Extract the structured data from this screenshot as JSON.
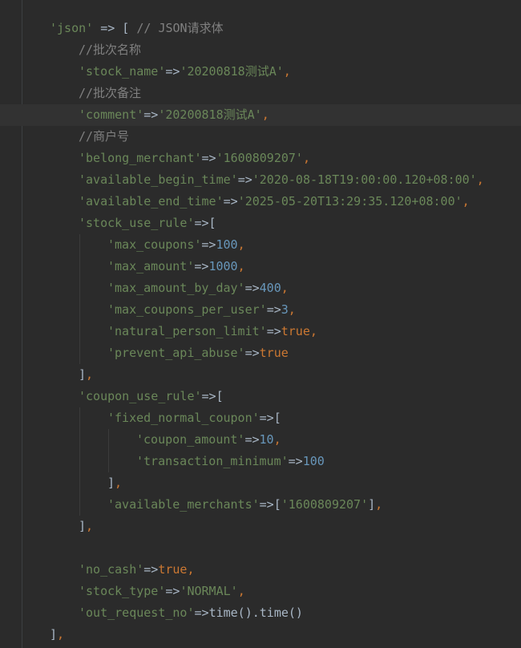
{
  "editor": {
    "current_line": 4,
    "lines": [
      {
        "indent": 0,
        "tokens": [
          {
            "t": "'json'",
            "c": "str"
          },
          {
            "t": " => [ ",
            "c": "op"
          },
          {
            "t": "// JSON请求体",
            "c": "cmt"
          }
        ]
      },
      {
        "indent": 1,
        "tokens": [
          {
            "t": "//批次名称",
            "c": "cmt"
          }
        ]
      },
      {
        "indent": 1,
        "tokens": [
          {
            "t": "'stock_name'",
            "c": "str"
          },
          {
            "t": "=>",
            "c": "op"
          },
          {
            "t": "'20200818测试A'",
            "c": "str"
          },
          {
            "t": ",",
            "c": "kw"
          }
        ]
      },
      {
        "indent": 1,
        "tokens": [
          {
            "t": "//批次备注",
            "c": "cmt"
          }
        ]
      },
      {
        "indent": 1,
        "tokens": [
          {
            "t": "'comment'",
            "c": "str"
          },
          {
            "t": "=>",
            "c": "op"
          },
          {
            "t": "'20200818测试A'",
            "c": "str"
          },
          {
            "t": ",",
            "c": "kw"
          }
        ]
      },
      {
        "indent": 1,
        "tokens": [
          {
            "t": "//商户号",
            "c": "cmt"
          }
        ]
      },
      {
        "indent": 1,
        "tokens": [
          {
            "t": "'belong_merchant'",
            "c": "str"
          },
          {
            "t": "=>",
            "c": "op"
          },
          {
            "t": "'1600809207'",
            "c": "str"
          },
          {
            "t": ",",
            "c": "kw"
          }
        ]
      },
      {
        "indent": 1,
        "tokens": [
          {
            "t": "'available_begin_time'",
            "c": "str"
          },
          {
            "t": "=>",
            "c": "op"
          },
          {
            "t": "'2020-08-18T19:00:00.120+08:00'",
            "c": "str"
          },
          {
            "t": ",",
            "c": "kw"
          }
        ]
      },
      {
        "indent": 1,
        "tokens": [
          {
            "t": "'available_end_time'",
            "c": "str"
          },
          {
            "t": "=>",
            "c": "op"
          },
          {
            "t": "'2025-05-20T13:29:35.120+08:00'",
            "c": "str"
          },
          {
            "t": ",",
            "c": "kw"
          }
        ]
      },
      {
        "indent": 1,
        "tokens": [
          {
            "t": "'stock_use_rule'",
            "c": "str"
          },
          {
            "t": "=>[",
            "c": "op"
          }
        ]
      },
      {
        "indent": 2,
        "tokens": [
          {
            "t": "'max_coupons'",
            "c": "str"
          },
          {
            "t": "=>",
            "c": "op"
          },
          {
            "t": "100",
            "c": "num"
          },
          {
            "t": ",",
            "c": "kw"
          }
        ]
      },
      {
        "indent": 2,
        "tokens": [
          {
            "t": "'max_amount'",
            "c": "str"
          },
          {
            "t": "=>",
            "c": "op"
          },
          {
            "t": "1000",
            "c": "num"
          },
          {
            "t": ",",
            "c": "kw"
          }
        ]
      },
      {
        "indent": 2,
        "tokens": [
          {
            "t": "'max_amount_by_day'",
            "c": "str"
          },
          {
            "t": "=>",
            "c": "op"
          },
          {
            "t": "400",
            "c": "num"
          },
          {
            "t": ",",
            "c": "kw"
          }
        ]
      },
      {
        "indent": 2,
        "tokens": [
          {
            "t": "'max_coupons_per_user'",
            "c": "str"
          },
          {
            "t": "=>",
            "c": "op"
          },
          {
            "t": "3",
            "c": "num"
          },
          {
            "t": ",",
            "c": "kw"
          }
        ]
      },
      {
        "indent": 2,
        "tokens": [
          {
            "t": "'natural_person_limit'",
            "c": "str"
          },
          {
            "t": "=>",
            "c": "op"
          },
          {
            "t": "true",
            "c": "kw"
          },
          {
            "t": ",",
            "c": "kw"
          }
        ]
      },
      {
        "indent": 2,
        "tokens": [
          {
            "t": "'prevent_api_abuse'",
            "c": "str"
          },
          {
            "t": "=>",
            "c": "op"
          },
          {
            "t": "true",
            "c": "kw"
          }
        ]
      },
      {
        "indent": 1,
        "tokens": [
          {
            "t": "]",
            "c": "op"
          },
          {
            "t": ",",
            "c": "kw"
          }
        ]
      },
      {
        "indent": 1,
        "tokens": [
          {
            "t": "'coupon_use_rule'",
            "c": "str"
          },
          {
            "t": "=>[",
            "c": "op"
          }
        ]
      },
      {
        "indent": 2,
        "tokens": [
          {
            "t": "'fixed_normal_coupon'",
            "c": "str"
          },
          {
            "t": "=>[",
            "c": "op"
          }
        ]
      },
      {
        "indent": 3,
        "tokens": [
          {
            "t": "'coupon_amount'",
            "c": "str"
          },
          {
            "t": "=>",
            "c": "op"
          },
          {
            "t": "10",
            "c": "num"
          },
          {
            "t": ",",
            "c": "kw"
          }
        ]
      },
      {
        "indent": 3,
        "tokens": [
          {
            "t": "'transaction_minimum'",
            "c": "str"
          },
          {
            "t": "=>",
            "c": "op"
          },
          {
            "t": "100",
            "c": "num"
          }
        ]
      },
      {
        "indent": 2,
        "tokens": [
          {
            "t": "]",
            "c": "op"
          },
          {
            "t": ",",
            "c": "kw"
          }
        ]
      },
      {
        "indent": 2,
        "tokens": [
          {
            "t": "'available_merchants'",
            "c": "str"
          },
          {
            "t": "=>[",
            "c": "op"
          },
          {
            "t": "'1600809207'",
            "c": "str"
          },
          {
            "t": "]",
            "c": "op"
          },
          {
            "t": ",",
            "c": "kw"
          }
        ]
      },
      {
        "indent": 1,
        "tokens": [
          {
            "t": "]",
            "c": "op"
          },
          {
            "t": ",",
            "c": "kw"
          }
        ]
      },
      {
        "indent": 1,
        "tokens": []
      },
      {
        "indent": 1,
        "tokens": [
          {
            "t": "'no_cash'",
            "c": "str"
          },
          {
            "t": "=>",
            "c": "op"
          },
          {
            "t": "true",
            "c": "kw"
          },
          {
            "t": ",",
            "c": "kw"
          }
        ]
      },
      {
        "indent": 1,
        "tokens": [
          {
            "t": "'stock_type'",
            "c": "str"
          },
          {
            "t": "=>",
            "c": "op"
          },
          {
            "t": "'NORMAL'",
            "c": "str"
          },
          {
            "t": ",",
            "c": "kw"
          }
        ]
      },
      {
        "indent": 1,
        "tokens": [
          {
            "t": "'out_request_no'",
            "c": "str"
          },
          {
            "t": "=>",
            "c": "op"
          },
          {
            "t": "time().time()",
            "c": "op"
          }
        ]
      },
      {
        "indent": 0,
        "tokens": [
          {
            "t": "]",
            "c": "op"
          },
          {
            "t": ",",
            "c": "kw"
          }
        ]
      }
    ]
  }
}
